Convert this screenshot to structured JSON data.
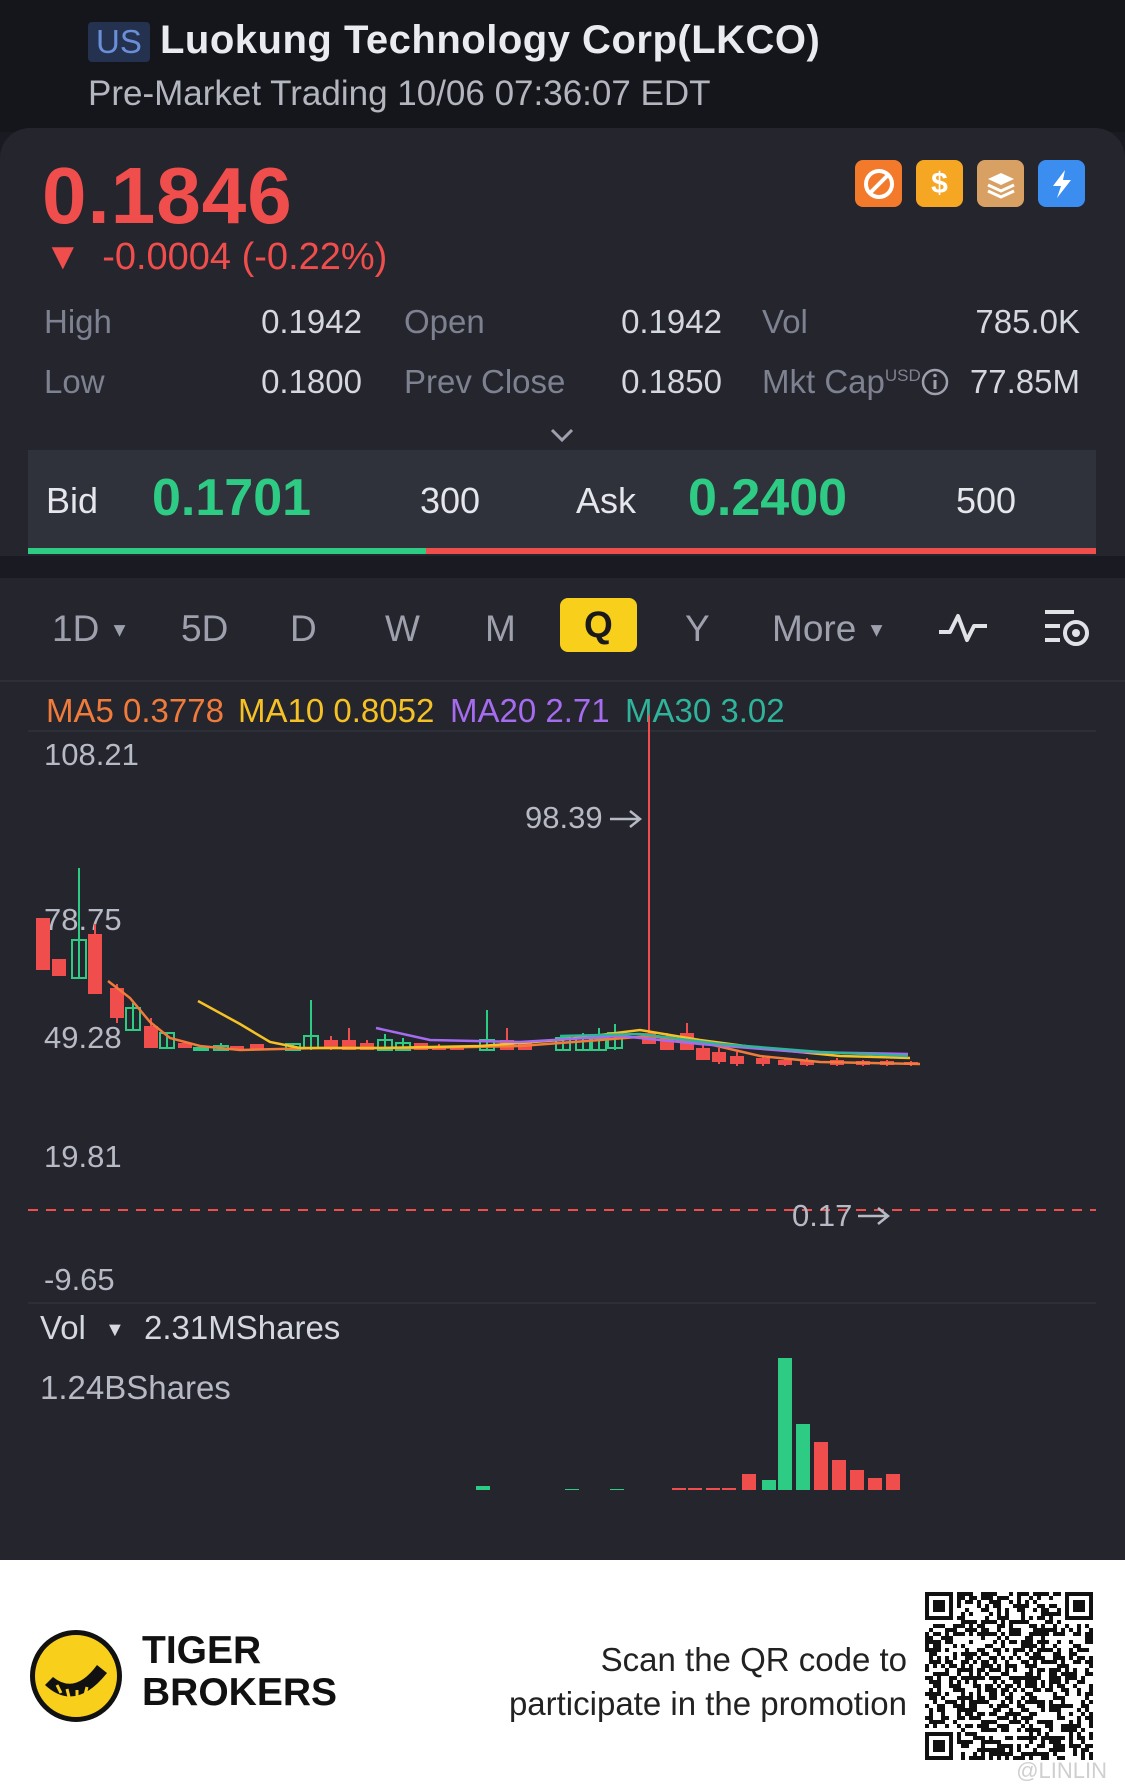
{
  "header": {
    "region": "US",
    "title": "Luokung Technology Corp(LKCO)",
    "session": "Pre-Market Trading 10/06 07:36:07 EDT"
  },
  "quote": {
    "price": "0.1846",
    "change_arrow": "▼",
    "change": "-0.0004 (-0.22%)",
    "badges": [
      "no-sign-icon",
      "dollar-icon",
      "stack-icon",
      "lightning-icon"
    ],
    "stats": {
      "high_label": "High",
      "high": "0.1942",
      "low_label": "Low",
      "low": "0.1800",
      "open_label": "Open",
      "open": "0.1942",
      "prev_close_label": "Prev Close",
      "prev_close": "0.1850",
      "vol_label": "Vol",
      "vol": "785.0K",
      "mkt_cap_label": "Mkt Cap",
      "mkt_cap_unit": "USD",
      "mkt_cap": "77.85M"
    }
  },
  "bidask": {
    "bid_label": "Bid",
    "bid": "0.1701",
    "bid_size": "300",
    "ask_label": "Ask",
    "ask": "0.2400",
    "ask_size": "500"
  },
  "tabs": {
    "t1d": "1D",
    "t5d": "5D",
    "td": "D",
    "tw": "W",
    "tm": "M",
    "tq": "Q",
    "ty": "Y",
    "more": "More"
  },
  "ma": {
    "ma5": "MA5 0.3778",
    "ma10": "MA10 0.8052",
    "ma20": "MA20 2.71",
    "ma30": "MA30 3.02"
  },
  "chart": {
    "y_labels": [
      "108.21",
      "78.75",
      "49.28",
      "19.81",
      "-9.65"
    ],
    "high_marker": "98.39",
    "last_marker": "0.17",
    "colors": {
      "up": "#2ecb84",
      "down": "#f04d4d",
      "ma5": "#f07b3a",
      "ma10": "#f5c125",
      "ma20": "#a66cf0",
      "ma30": "#2fb39a"
    }
  },
  "volume": {
    "label": "Vol",
    "current": "2.31MShares",
    "max": "1.24BShares"
  },
  "footer": {
    "brand_line1": "TIGER",
    "brand_line2": "BROKERS",
    "promo_line1": "Scan the QR code to",
    "promo_line2": "participate in the promotion",
    "watermark": "@LINLIN"
  }
}
